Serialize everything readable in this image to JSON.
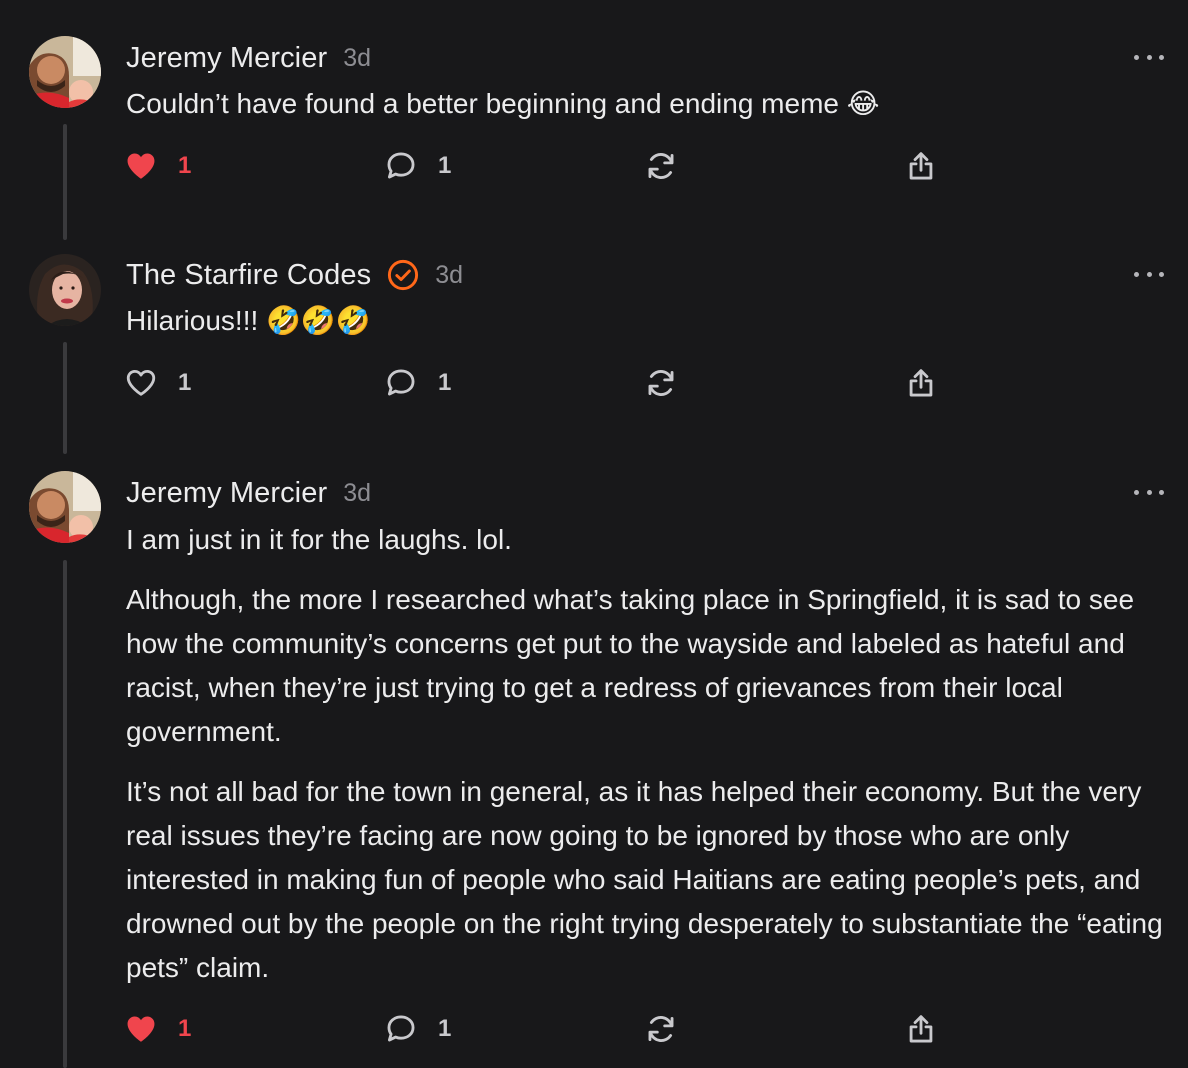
{
  "comments": [
    {
      "author": "Jeremy Mercier",
      "time": "3d",
      "verified": false,
      "paragraphs": [
        "Couldn’t have found a better beginning and ending meme 😂"
      ],
      "like_count": "1",
      "liked": true,
      "reply_count": "1"
    },
    {
      "author": "The Starfire Codes",
      "time": "3d",
      "verified": true,
      "paragraphs": [
        "Hilarious!!! 🤣🤣🤣"
      ],
      "like_count": "1",
      "liked": false,
      "reply_count": "1"
    },
    {
      "author": "Jeremy Mercier",
      "time": "3d",
      "verified": false,
      "paragraphs": [
        "I am just in it for the laughs. lol.",
        "Although, the more I researched what’s taking place in Springfield, it is sad to see how the community’s concerns get put to the wayside and labeled as hateful and racist, when they’re just trying to get a redress of grievances from their local government.",
        "It’s not all bad for the town in general, as it has helped their economy. But the very real issues they’re facing are now going to be ignored by those who are only interested in making fun of people who said Haitians are eating people’s pets, and drowned out by the people on the right trying desperately to substantiate the “eating pets” claim."
      ],
      "like_count": "1",
      "liked": true,
      "reply_count": "1"
    }
  ],
  "colors": {
    "background": "#18181a",
    "liked": "#f0454d",
    "verified": "#ff6719",
    "muted": "#8d8d92"
  },
  "icons": [
    "heart-icon",
    "comment-icon",
    "restack-icon",
    "share-icon",
    "more-icon",
    "verified-icon"
  ]
}
